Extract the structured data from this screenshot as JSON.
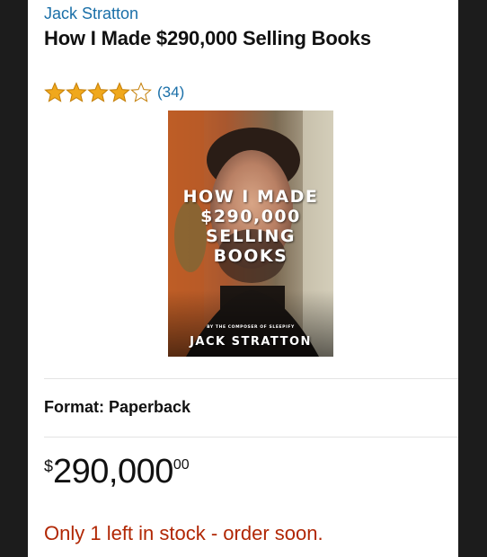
{
  "product": {
    "author": "Jack Stratton",
    "title": "How I Made $290,000 Selling Books",
    "rating": {
      "stars_filled": 4,
      "stars_total": 5,
      "review_count": "(34)",
      "star_color": "#f0a81c"
    },
    "cover": {
      "title_lines": [
        "HOW I MADE",
        "$290,000",
        "SELLING",
        "BOOKS"
      ],
      "subtitle": "BY THE COMPOSER OF SLEEPIFY",
      "author": "JACK STRATTON"
    },
    "format_label": "Format: Paperback",
    "price": {
      "symbol": "$",
      "whole": "290,000",
      "fraction": "00"
    },
    "stock_message": "Only 1 left in stock - order soon."
  },
  "colors": {
    "link": "#1a6fa8",
    "stock": "#b12704",
    "frame": "#1c1c1c"
  }
}
